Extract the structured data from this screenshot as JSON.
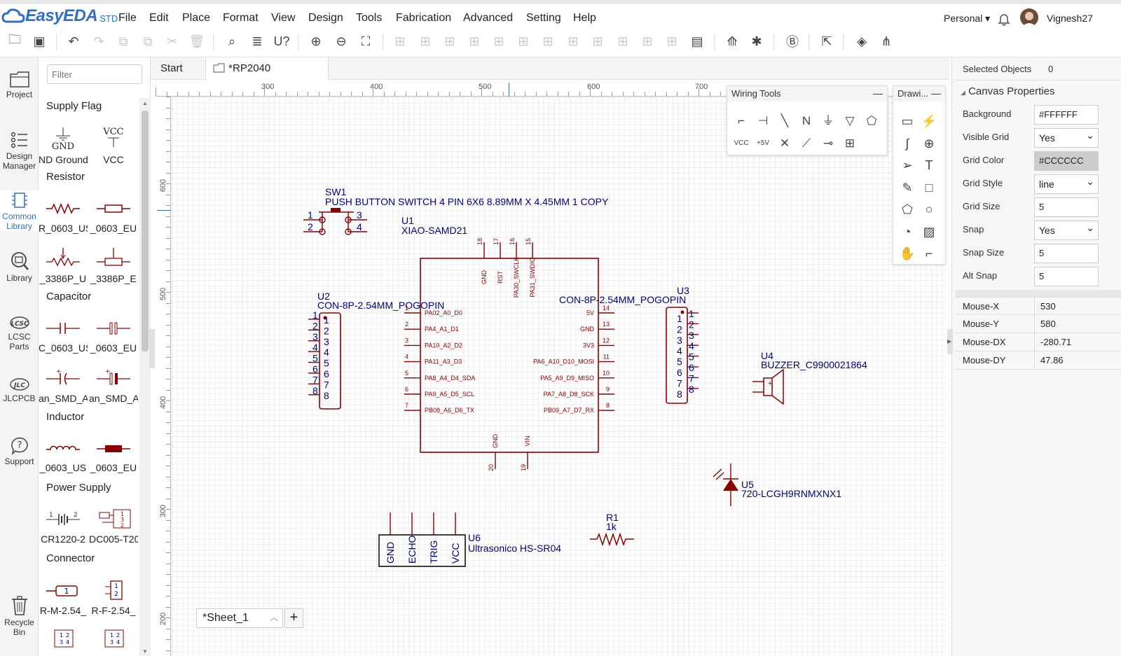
{
  "app": {
    "brand": "EasyEDA",
    "edition": "STD"
  },
  "menu": [
    "File",
    "Edit",
    "Place",
    "Format",
    "View",
    "Design",
    "Tools",
    "Fabrication",
    "Advanced",
    "Setting",
    "Help"
  ],
  "account": {
    "workspace": "Personal",
    "username": "Vignesh27"
  },
  "toolbar": {
    "icons": [
      "open-icon",
      "save-icon",
      "undo-icon",
      "redo-icon",
      "copy-icon",
      "paste-icon",
      "cut-icon",
      "delete-icon",
      "search-icon",
      "find-replace-icon",
      "net-icon",
      "zoom-in-icon",
      "zoom-out-icon",
      "fit-icon",
      "rotate-left-icon",
      "rotate-right-icon",
      "flip-h-icon",
      "flip-v-icon",
      "align-left-icon",
      "align-right-icon",
      "align-top-icon",
      "align-bottom-icon",
      "align-center-h-icon",
      "align-center-v-icon",
      "distribute-h-icon",
      "distribute-v-icon",
      "bom-icon",
      "convert-pcb-icon",
      "pin-icon",
      "netlist-icon",
      "export-icon",
      "layers-icon",
      "share-icon"
    ]
  },
  "left_nav": [
    {
      "label1": "Project",
      "label2": ""
    },
    {
      "label1": "Design",
      "label2": "Manager"
    },
    {
      "label1": "Common",
      "label2": "Library"
    },
    {
      "label1": "Library",
      "label2": ""
    },
    {
      "label1": "LCSC",
      "label2": "Parts"
    },
    {
      "label1": "JLCPCB",
      "label2": ""
    },
    {
      "label1": "Support",
      "label2": ""
    },
    {
      "label1": "Recycle",
      "label2": "Bin"
    }
  ],
  "library": {
    "filter_placeholder": "Filter",
    "categories": [
      "Supply Flag",
      "Resistor",
      "Capacitor",
      "Inductor",
      "Power Supply",
      "Connector"
    ],
    "parts": [
      [
        "ND Ground",
        "VCC"
      ],
      [
        "R_0603_US",
        "_0603_EU"
      ],
      [
        "_3386P_U",
        "_3386P_E"
      ],
      [
        "C_0603_US",
        "_0603_EU"
      ],
      [
        "an_SMD_A",
        "an_SMD_A"
      ],
      [
        "_0603_US",
        "_0603_EU"
      ],
      [
        "CR1220-2",
        "DC005-T20"
      ],
      [
        "R-M-2.54_",
        "R-F-2.54_"
      ]
    ],
    "supply_text": {
      "gnd": "GND",
      "vcc": "VCC"
    }
  },
  "tabs": [
    {
      "label": "Start"
    },
    {
      "label": "*RP2040"
    }
  ],
  "ruler": {
    "h": [
      "300",
      "400",
      "500",
      "600",
      "700"
    ],
    "v": [
      "600",
      "500",
      "400",
      "300",
      "200"
    ]
  },
  "schematic": {
    "sw1": {
      "ref": "SW1",
      "value": "PUSH BUTTON SWITCH 4 PIN 6X6 8.89MM X 4.45MM 1 COPY",
      "pins": [
        "1",
        "2",
        "3",
        "4"
      ]
    },
    "u1": {
      "ref": "U1",
      "value": "XIAO-SAMD21",
      "left_pins": [
        "PA02_A0_D0",
        "PA4_A1_D1",
        "PA10_A2_D2",
        "PA11_A3_D3",
        "PA8_A4_D4_SDA",
        "PA9_A5_D5_SCL",
        "PB08_A6_D6_TX"
      ],
      "left_nums": [
        "1",
        "2",
        "3",
        "4",
        "5",
        "6",
        "7"
      ],
      "right_pins": [
        "5V",
        "GND",
        "3V3",
        "PA6_A10_D10_MOSI",
        "PA5_A9_D9_MISO",
        "PA7_A8_D8_SCK",
        "PB09_A7_D7_RX"
      ],
      "right_nums": [
        "14",
        "13",
        "12",
        "11",
        "10",
        "9",
        "8"
      ],
      "top_pins": [
        "GND",
        "RST",
        "PA30_SWCLK",
        "PA31_SWDIO"
      ],
      "top_nums": [
        "18",
        "17",
        "16",
        "15"
      ],
      "bottom_pins": [
        "GND",
        "VIN"
      ],
      "bottom_nums": [
        "20",
        "19"
      ]
    },
    "u2": {
      "ref": "U2",
      "value": "CON-8P-2.54MM_POGOPIN",
      "pins": [
        "1",
        "2",
        "3",
        "4",
        "5",
        "6",
        "7",
        "8"
      ]
    },
    "u3": {
      "ref": "U3",
      "value": "CON-8P-2.54MM_POGOPIN",
      "pins": [
        "1",
        "2",
        "3",
        "4",
        "5",
        "6",
        "7",
        "8"
      ]
    },
    "u4": {
      "ref": "U4",
      "value": "BUZZER_C9900021864"
    },
    "u5": {
      "ref": "U5",
      "value": "720-LCGH9RNMXNX1"
    },
    "u6": {
      "ref": "U6",
      "value": "Ultrasonico HS-SR04",
      "pins": [
        "GND",
        "ECHO",
        "TRIG",
        "VCC"
      ]
    },
    "r1": {
      "ref": "R1",
      "value": "1k"
    }
  },
  "wiring_tools": {
    "title": "Wiring Tools",
    "icons": [
      "wire-icon",
      "bus-icon",
      "bus-entry-icon",
      "net-label-icon",
      "netflag-gnd-icon",
      "netflag-ground-icon",
      "net-port-icon",
      "netflag-vcc-icon",
      "netflag-5v-icon",
      "no-connect-icon",
      "voltage-probe-icon",
      "pin-icon",
      "group-icon"
    ],
    "vcc": "VCC",
    "v5": "+5V"
  },
  "drawing_tools": {
    "title": "Drawi...",
    "icons": [
      "image-frame-icon",
      "line-icon",
      "bezier-icon",
      "arc-icon",
      "arrowhead-icon",
      "text-icon",
      "freehand-icon",
      "rectangle-icon",
      "polygon-icon",
      "circle-icon",
      "pie-icon",
      "image-icon",
      "pan-icon",
      "drag-icon"
    ]
  },
  "properties": {
    "selected_label": "Selected Objects",
    "selected_count": "0",
    "section": "Canvas Properties",
    "background_label": "Background",
    "background": "#FFFFFF",
    "visible_grid_label": "Visible Grid",
    "visible_grid": "Yes",
    "grid_color_label": "Grid Color",
    "grid_color": "#CCCCCC",
    "grid_style_label": "Grid Style",
    "grid_style": "line",
    "grid_size_label": "Grid Size",
    "grid_size": "5",
    "snap_label": "Snap",
    "snap": "Yes",
    "snap_size_label": "Snap Size",
    "snap_size": "5",
    "alt_snap_label": "Alt Snap",
    "alt_snap": "5",
    "mouse": [
      {
        "k": "Mouse-X",
        "v": "530"
      },
      {
        "k": "Mouse-Y",
        "v": "580"
      },
      {
        "k": "Mouse-DX",
        "v": "-280.71"
      },
      {
        "k": "Mouse-DY",
        "v": "47.86"
      }
    ]
  },
  "sheet": {
    "name": "*Sheet_1",
    "add": "+"
  },
  "colors": {
    "accent": "#2f6fc6",
    "schematic_line": "#880000",
    "schematic_text": "#000080",
    "grid": "#ececec"
  }
}
